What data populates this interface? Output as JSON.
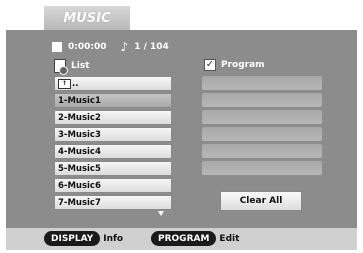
{
  "tab_title": "MUSIC",
  "status": {
    "time": "0:00:00",
    "track": "1 / 104",
    "stop_icon": "stop-icon",
    "note_icon": "music-note-icon"
  },
  "list": {
    "header": "List",
    "parent_label": "..",
    "items": [
      "1-Music1",
      "2-Music2",
      "3-Music3",
      "4-Music4",
      "5-Music5",
      "6-Music6",
      "7-Music7"
    ],
    "selected_index": 0
  },
  "program": {
    "header": "Program",
    "slot_count": 8
  },
  "clear_all_label": "Clear All",
  "footer": {
    "display_button": "DISPLAY",
    "display_label": "Info",
    "program_button": "PROGRAM",
    "program_label": "Edit"
  },
  "colors": {
    "panel": "#8c8c8c",
    "footer": "#d0d0d0",
    "selected_row": "#b3b3b3"
  }
}
